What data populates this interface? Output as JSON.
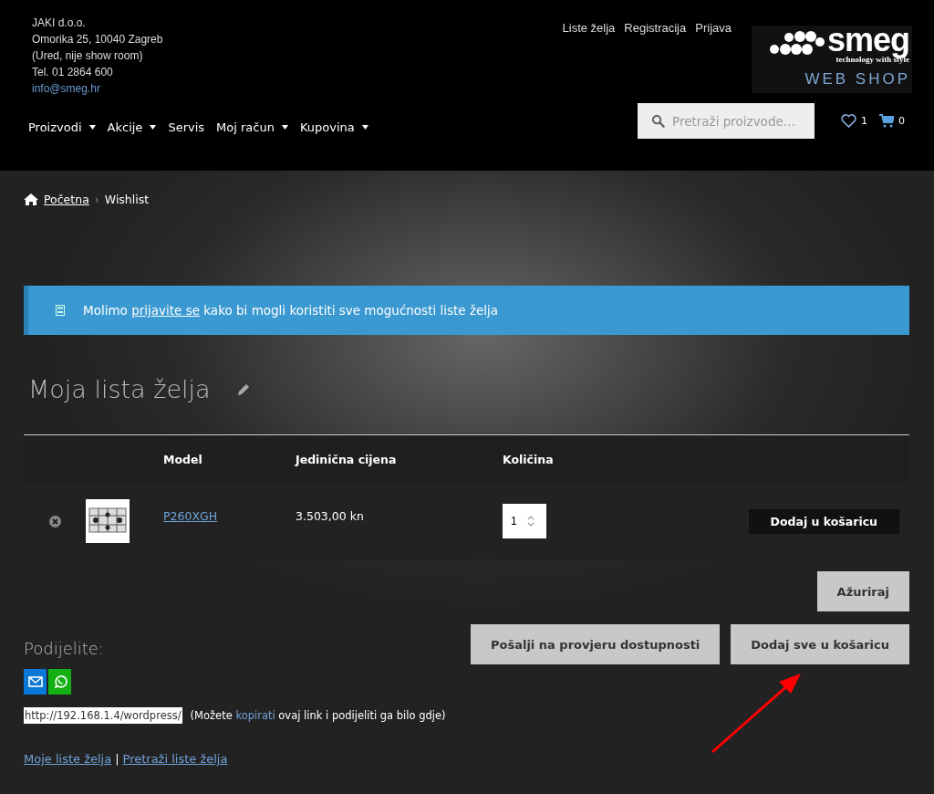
{
  "contact": {
    "lines": [
      "JAKI d.o.o.",
      "Omorika 25, 10040 Zagreb",
      "(Ured, nije show room)",
      "Tel. 01 2864 600"
    ],
    "email": "info@smeg.hr"
  },
  "top_links": [
    "Liste želja",
    "Registracija",
    "Prijava"
  ],
  "logo": {
    "brand": "smeg",
    "tagline": "technology with style",
    "subtitle": "WEB SHOP"
  },
  "nav": [
    {
      "label": "Proizvodi",
      "dropdown": true
    },
    {
      "label": "Akcije",
      "dropdown": true
    },
    {
      "label": "Servis",
      "dropdown": false
    },
    {
      "label": "Moj račun",
      "dropdown": true
    },
    {
      "label": "Kupovina",
      "dropdown": true
    }
  ],
  "search": {
    "placeholder": "Pretraži proizvode…"
  },
  "wishlist_count": "1",
  "cart_count": "0",
  "breadcrumb": {
    "home": "Početna",
    "separator": "›",
    "current": "Wishlist"
  },
  "notice": {
    "before": "Molimo ",
    "link": "prijavite se",
    "after": " kako bi mogli koristiti sve mogućnosti liste želja"
  },
  "title": "Moja lista želja",
  "table": {
    "columns": [
      "Model",
      "Jedinična cijena",
      "Količina"
    ],
    "rows": [
      {
        "model": "P260XGH",
        "price": "3.503,00 kn",
        "quantity": "1",
        "action": "Dodaj u košaricu"
      }
    ]
  },
  "buttons": {
    "update": "Ažuriraj",
    "check": "Pošalji na provjeru dostupnosti",
    "add_all": "Dodaj sve u košaricu"
  },
  "share": {
    "heading": "Podijelite:",
    "url": "http://192.168.1.4/wordpress/",
    "hint_before": "(Možete ",
    "hint_link": "kopirati",
    "hint_after": " ovaj link i podijeliti ga bilo gdje)"
  },
  "footer_links": [
    "Moje liste želja",
    "Pretraži liste želja"
  ],
  "footer_separator": "|",
  "annotation_arrow": true
}
